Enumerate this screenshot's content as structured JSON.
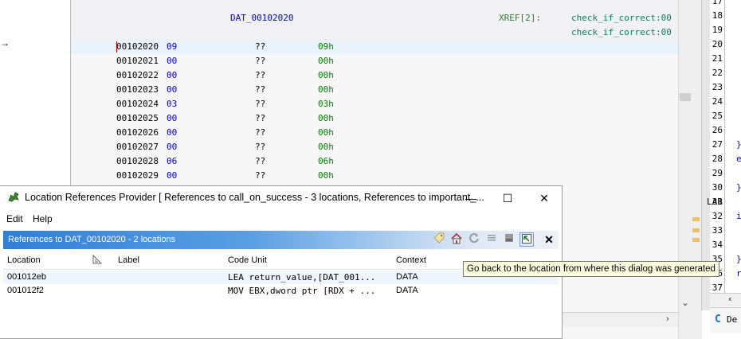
{
  "listing": {
    "data_label": "DAT_00102020",
    "xref_label": "XREF[2]:",
    "xrefs": [
      "check_if_correct:00",
      "check_if_correct:00"
    ],
    "rows": [
      {
        "addr": "00102020",
        "byte": "09",
        "qq": "??",
        "val": "09h"
      },
      {
        "addr": "00102021",
        "byte": "00",
        "qq": "??",
        "val": "00h"
      },
      {
        "addr": "00102022",
        "byte": "00",
        "qq": "??",
        "val": "00h"
      },
      {
        "addr": "00102023",
        "byte": "00",
        "qq": "??",
        "val": "00h"
      },
      {
        "addr": "00102024",
        "byte": "03",
        "qq": "??",
        "val": "03h"
      },
      {
        "addr": "00102025",
        "byte": "00",
        "qq": "??",
        "val": "00h"
      },
      {
        "addr": "00102026",
        "byte": "00",
        "qq": "??",
        "val": "00h"
      },
      {
        "addr": "00102027",
        "byte": "00",
        "qq": "??",
        "val": "00h"
      },
      {
        "addr": "00102028",
        "byte": "06",
        "qq": "??",
        "val": "06h"
      },
      {
        "addr": "00102029",
        "byte": "00",
        "qq": "??",
        "val": "00h"
      }
    ]
  },
  "left_arrow": "→",
  "decompiler": {
    "lines": [
      {
        "n": "17",
        "code": ""
      },
      {
        "n": "18",
        "code": ""
      },
      {
        "n": "19",
        "code": ""
      },
      {
        "n": "20",
        "code": ""
      },
      {
        "n": "21",
        "code": ""
      },
      {
        "n": "22",
        "code": ""
      },
      {
        "n": "23",
        "code": ""
      },
      {
        "n": "24",
        "code": ""
      },
      {
        "n": "25",
        "code": ""
      },
      {
        "n": "26",
        "code": ""
      },
      {
        "n": "27",
        "code": "}"
      },
      {
        "n": "28",
        "code": "e"
      },
      {
        "n": "29",
        "code": ""
      },
      {
        "n": "30",
        "code": "}"
      },
      {
        "n": "31",
        "code": "LAB"
      },
      {
        "n": "32",
        "code": "i"
      },
      {
        "n": "33",
        "code": ""
      },
      {
        "n": "34",
        "code": ""
      },
      {
        "n": "35",
        "code": "}"
      },
      {
        "n": "36",
        "code": "r"
      },
      {
        "n": "37",
        "code": ""
      }
    ],
    "tab_label": "De",
    "tab_icon": "C"
  },
  "dialog": {
    "title": "Location References Provider [ References to call_on_success - 3 locations, References to important_...",
    "minimize": "—",
    "maximize": "☐",
    "close": "✕",
    "menu": [
      "Edit",
      "Help"
    ],
    "panel_title": "References to DAT_00102020 - 2 locations",
    "columns": {
      "location": "Location",
      "label": "Label",
      "code_unit": "Code Unit",
      "context": "Context"
    },
    "rows": [
      {
        "location": "001012eb",
        "label": "",
        "code_unit": "LEA return_value,[DAT_001...",
        "context": "DATA"
      },
      {
        "location": "001012f2",
        "label": "",
        "code_unit": "MOV EBX,dword ptr [RDX + ...",
        "context": "DATA"
      }
    ]
  },
  "tooltip": "Go back to the location from where this dialog was generated",
  "scroll": {
    "down_arrow": "⌄",
    "right_arrow": "›"
  }
}
